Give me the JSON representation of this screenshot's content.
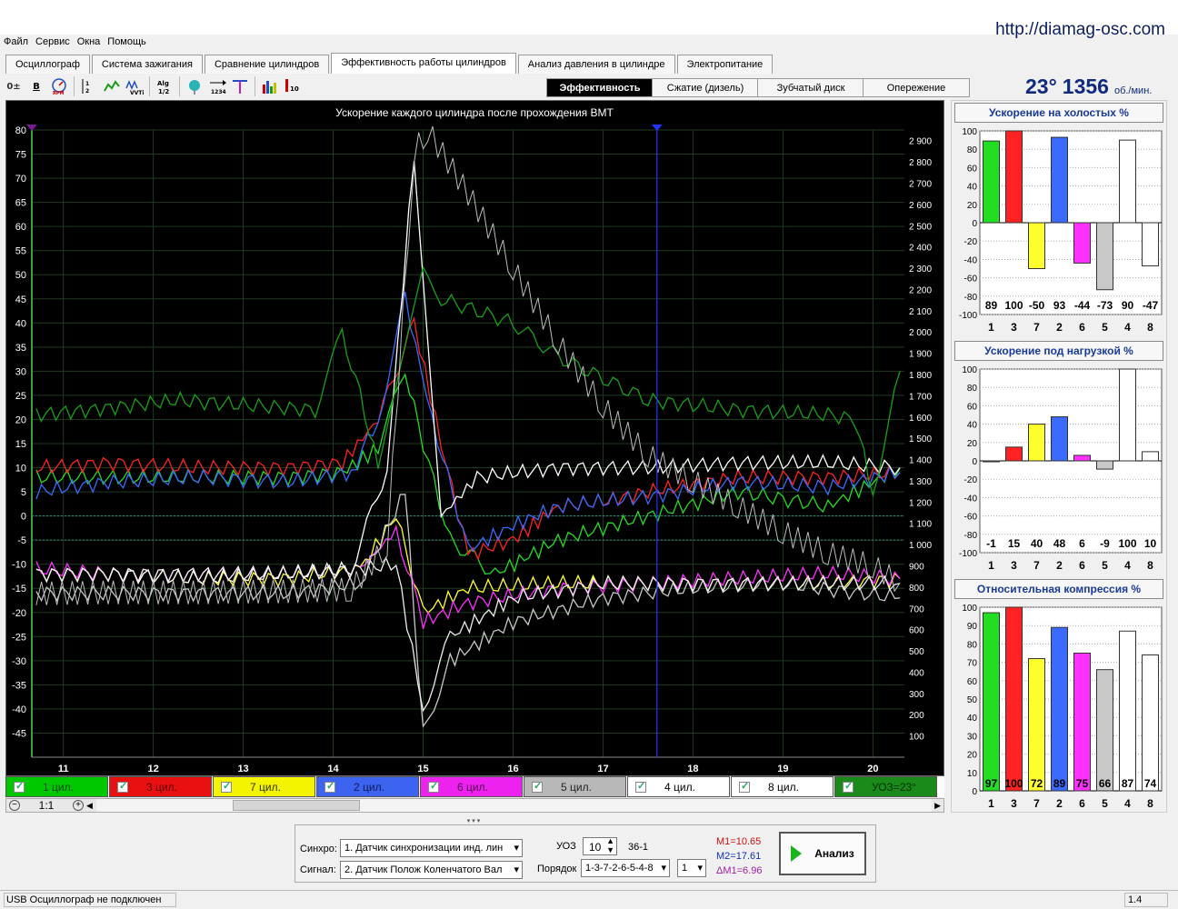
{
  "site_url": "http://diamag-osc.com",
  "menu": [
    "Файл",
    "Сервис",
    "Окна",
    "Помощь"
  ],
  "tabs": [
    "Осциллограф",
    "Система зажигания",
    "Сравнение цилиндров",
    "Эффективность работы цилиндров",
    "Анализ давления в цилиндре",
    "Электропитание"
  ],
  "active_tab": "Эффективность работы цилиндров",
  "toolbar_icons": [
    "offset-icon",
    "bold-icon",
    "rpm-icon",
    "ticks-icon",
    "curve-icon",
    "vvti-icon",
    "algorithm-icon",
    "filter-icon",
    "order-icon",
    "marker-icon",
    "car-icon",
    "bars-icon"
  ],
  "subtabs": [
    "Эффективность",
    "Сжатие (дизель)",
    "Зубчатый диск",
    "Опережение"
  ],
  "active_subtab": "Эффективность",
  "angle": "23°",
  "rpm_value": "1356",
  "rpm_unit": "об./мин.",
  "chart_data": {
    "type": "line",
    "title": "Ускорение каждого цилиндра после прохождения ВМТ",
    "x_ticks": [
      11,
      12,
      13,
      14,
      15,
      16,
      17,
      18,
      19,
      20
    ],
    "xlim": [
      10.65,
      20.35
    ],
    "y_left_ticks": [
      80,
      75,
      70,
      65,
      60,
      55,
      50,
      45,
      40,
      35,
      30,
      25,
      20,
      15,
      10,
      5,
      0,
      -5,
      -10,
      -15,
      -20,
      -25,
      -30,
      -35,
      -40,
      -45
    ],
    "ylim_left": [
      -50,
      80
    ],
    "y_right_ticks": [
      "2 900",
      "2 800",
      "2 700",
      "2 600",
      "2 500",
      "2 400",
      "2 300",
      "2 200",
      "2 100",
      "2 000",
      "1 900",
      "1 800",
      "1 700",
      "1 600",
      "1 500",
      "1 400",
      "1 300",
      "1 200",
      "1 100",
      "1 000",
      "900",
      "800",
      "700",
      "600",
      "500",
      "400",
      "300",
      "200",
      "100"
    ],
    "ylim_right": [
      0,
      2950
    ],
    "cursor_x": 17.6,
    "dotted_levels": [
      0,
      -5
    ],
    "series": [
      {
        "name": "1 цил.",
        "color": "#22dd22",
        "values": [
          [
            10.7,
            8
          ],
          [
            11.5,
            8
          ],
          [
            12.5,
            8
          ],
          [
            13.5,
            8
          ],
          [
            14.1,
            9
          ],
          [
            14.5,
            14
          ],
          [
            14.8,
            30
          ],
          [
            15.0,
            15
          ],
          [
            15.3,
            -5
          ],
          [
            15.8,
            -12
          ],
          [
            16.5,
            -5
          ],
          [
            17.5,
            0
          ],
          [
            18.5,
            5
          ],
          [
            19.5,
            2
          ],
          [
            20.3,
            10
          ]
        ]
      },
      {
        "name": "3 цил.",
        "color": "#ff2222",
        "values": [
          [
            10.7,
            10
          ],
          [
            11.5,
            11
          ],
          [
            12.5,
            10
          ],
          [
            13.5,
            10
          ],
          [
            14.1,
            11
          ],
          [
            14.5,
            20
          ],
          [
            14.9,
            40
          ],
          [
            15.2,
            15
          ],
          [
            15.5,
            -8
          ],
          [
            16.0,
            -5
          ],
          [
            16.5,
            2
          ],
          [
            17.0,
            3
          ],
          [
            17.5,
            5
          ],
          [
            18.5,
            8
          ],
          [
            19.5,
            8
          ],
          [
            20.3,
            9
          ]
        ]
      },
      {
        "name": "7 цил.",
        "color": "#ffff30",
        "values": [
          [
            10.7,
            -12
          ],
          [
            11.5,
            -12
          ],
          [
            12.5,
            -13
          ],
          [
            13.5,
            -13
          ],
          [
            14.3,
            -11
          ],
          [
            14.7,
            0
          ],
          [
            15.0,
            -20
          ],
          [
            15.5,
            -15
          ],
          [
            16.5,
            -14
          ],
          [
            17.5,
            -14
          ],
          [
            18.5,
            -14
          ],
          [
            19.5,
            -14
          ],
          [
            20.3,
            -13
          ]
        ]
      },
      {
        "name": "2 цил.",
        "color": "#3a6aff",
        "values": [
          [
            10.7,
            5
          ],
          [
            11.5,
            7
          ],
          [
            12.5,
            8
          ],
          [
            13.5,
            7
          ],
          [
            14.2,
            9
          ],
          [
            14.5,
            20
          ],
          [
            14.8,
            45
          ],
          [
            15.1,
            20
          ],
          [
            15.5,
            -7
          ],
          [
            16.0,
            -2
          ],
          [
            16.5,
            2
          ],
          [
            17.5,
            4
          ],
          [
            18.5,
            7
          ],
          [
            19.5,
            6
          ],
          [
            20.3,
            9
          ]
        ]
      },
      {
        "name": "6 цил.",
        "color": "#ff30ff",
        "values": [
          [
            10.7,
            -11
          ],
          [
            11.5,
            -12
          ],
          [
            12.5,
            -12
          ],
          [
            13.5,
            -12
          ],
          [
            14.3,
            -11
          ],
          [
            14.7,
            -3
          ],
          [
            15.0,
            -22
          ],
          [
            15.5,
            -18
          ],
          [
            16.5,
            -15
          ],
          [
            17.5,
            -14
          ],
          [
            18.5,
            -13
          ],
          [
            19.5,
            -12
          ],
          [
            20.3,
            -13
          ]
        ]
      },
      {
        "name": "5 цил.",
        "color": "#c8c8c8",
        "values": [
          [
            10.7,
            -16
          ],
          [
            11.5,
            -16
          ],
          [
            12.5,
            -16
          ],
          [
            13.5,
            -16
          ],
          [
            14.3,
            -14
          ],
          [
            14.8,
            5
          ],
          [
            15.0,
            -45
          ],
          [
            15.3,
            -30
          ],
          [
            16.0,
            -22
          ],
          [
            17.0,
            -17
          ],
          [
            18.0,
            -15
          ],
          [
            19.0,
            -14
          ],
          [
            20.3,
            -17
          ]
        ]
      },
      {
        "name": "4 цил.",
        "color": "#ffffff",
        "values": [
          [
            10.7,
            -12
          ],
          [
            11.5,
            -12
          ],
          [
            12.5,
            -13
          ],
          [
            13.5,
            -12
          ],
          [
            14.2,
            -11
          ],
          [
            14.6,
            10
          ],
          [
            14.9,
            75
          ],
          [
            15.2,
            0
          ],
          [
            15.6,
            8
          ],
          [
            16.5,
            10
          ],
          [
            17.5,
            10
          ],
          [
            18.5,
            11
          ],
          [
            19.5,
            11
          ],
          [
            20.3,
            10
          ]
        ]
      },
      {
        "name": "8 цил.",
        "color": "#eeeeee",
        "values": [
          [
            10.7,
            -12
          ],
          [
            11.5,
            -12
          ],
          [
            12.5,
            -12
          ],
          [
            13.5,
            -12
          ],
          [
            14.3,
            -11
          ],
          [
            14.7,
            -10
          ],
          [
            15.0,
            -40
          ],
          [
            15.3,
            -25
          ],
          [
            16.0,
            -17
          ],
          [
            17.0,
            -14
          ],
          [
            18.0,
            -14
          ],
          [
            19.0,
            -14
          ],
          [
            20.3,
            -14
          ]
        ]
      },
      {
        "name": "УОЗ=23°",
        "color": "#18a018",
        "values": [
          [
            10.7,
            21
          ],
          [
            11.3,
            22
          ],
          [
            12.3,
            24
          ],
          [
            13.0,
            23
          ],
          [
            13.8,
            22
          ],
          [
            14.1,
            38
          ],
          [
            14.3,
            25
          ],
          [
            14.5,
            10
          ],
          [
            15.0,
            50
          ],
          [
            15.2,
            45
          ],
          [
            16.0,
            40
          ],
          [
            16.5,
            33
          ],
          [
            17.5,
            24
          ],
          [
            18.5,
            22
          ],
          [
            19.5,
            21
          ],
          [
            19.8,
            20
          ],
          [
            20.0,
            5
          ],
          [
            20.3,
            30
          ]
        ]
      },
      {
        "name": "RPM",
        "color": "#bdbdbd",
        "axis": "right",
        "values": [
          [
            10.7,
            770
          ],
          [
            11.5,
            775
          ],
          [
            12.5,
            775
          ],
          [
            13.5,
            780
          ],
          [
            14.2,
            790
          ],
          [
            14.6,
            1000
          ],
          [
            14.9,
            2850
          ],
          [
            15.05,
            2950
          ],
          [
            15.5,
            2650
          ],
          [
            16.0,
            2300
          ],
          [
            16.5,
            1950
          ],
          [
            17.0,
            1650
          ],
          [
            17.5,
            1420
          ],
          [
            18.0,
            1300
          ],
          [
            18.5,
            1180
          ],
          [
            19.0,
            1060
          ],
          [
            19.5,
            960
          ],
          [
            20.0,
            900
          ],
          [
            20.3,
            820
          ]
        ]
      }
    ]
  },
  "legend": [
    {
      "label": "1 цил.",
      "bg": "#00c800",
      "fg": "#004400"
    },
    {
      "label": "3 цил.",
      "bg": "#e81010",
      "fg": "#5a0000"
    },
    {
      "label": "7 цил.",
      "bg": "#f4f400",
      "fg": "#333300"
    },
    {
      "label": "2 цил.",
      "bg": "#3c64f0",
      "fg": "#0a1a55"
    },
    {
      "label": "6 цил.",
      "bg": "#ee22ee",
      "fg": "#550055"
    },
    {
      "label": "5 цил.",
      "bg": "#b8b8b8",
      "fg": "#222222"
    },
    {
      "label": "4 цил.",
      "bg": "#ffffff",
      "fg": "#000000"
    },
    {
      "label": "8 цил.",
      "bg": "#ffffff",
      "fg": "#000000"
    },
    {
      "label": "УОЗ=23°",
      "bg": "#1a8a1a",
      "fg": "#003300"
    }
  ],
  "zoom_label": "1:1",
  "panels": [
    {
      "title": "Ускорение на холостых %",
      "ylim": [
        -100,
        100
      ],
      "ticks": [
        100,
        80,
        60,
        40,
        20,
        0,
        -20,
        -40,
        -60,
        -80,
        -100
      ],
      "labels": [
        "1",
        "3",
        "7",
        "2",
        "6",
        "5",
        "4",
        "8"
      ],
      "values": [
        89,
        100,
        -50,
        93,
        -44,
        -73,
        90,
        -47
      ],
      "value_text": [
        "89",
        "100",
        "-50",
        "93",
        "-44",
        "-73",
        "90",
        "-47"
      ]
    },
    {
      "title": "Ускорение под нагрузкой %",
      "ylim": [
        -100,
        100
      ],
      "ticks": [
        100,
        80,
        60,
        40,
        20,
        0,
        -20,
        -40,
        -60,
        -80,
        -100
      ],
      "labels": [
        "1",
        "3",
        "7",
        "2",
        "6",
        "5",
        "4",
        "8"
      ],
      "values": [
        -1,
        15,
        40,
        48,
        6,
        -9,
        100,
        10
      ],
      "value_text": [
        "-1",
        "15",
        "40",
        "48",
        "6",
        "-9",
        "100",
        "10"
      ]
    },
    {
      "title": "Относительная компрессия %",
      "ylim": [
        0,
        100
      ],
      "ticks": [
        100,
        90,
        80,
        70,
        60,
        50,
        40,
        30,
        20,
        10,
        0
      ],
      "labels": [
        "1",
        "3",
        "7",
        "2",
        "6",
        "5",
        "4",
        "8"
      ],
      "values": [
        97,
        100,
        72,
        89,
        75,
        66,
        87,
        74
      ],
      "value_text": [
        "97",
        "100",
        "72",
        "89",
        "75",
        "66",
        "87",
        "74"
      ]
    }
  ],
  "bar_colors": [
    "#22dd22",
    "#ff2222",
    "#ffff30",
    "#3a6aff",
    "#ff30ff",
    "#c8c8c8",
    "#ffffff",
    "#ffffff"
  ],
  "bottom": {
    "sync_label": "Синхро:",
    "sync_value": "1.  Датчик синхронизации инд. лин",
    "signal_label": "Сигнал:",
    "signal_value": "2.  Датчик Полож Коленчатого Вал",
    "uoz_label": "УОЗ",
    "uoz_value": "10",
    "teeth": "36-1",
    "order_label": "Порядок",
    "order_value": "1-3-7-2-6-5-4-8",
    "order_num": "1",
    "m1": "M1=10.65",
    "m2": "M2=17.61",
    "dm": "ΔM1=6.96",
    "analyze": "Анализ"
  },
  "status_left": "USB Осциллограф не подключен",
  "status_right": "1.4"
}
